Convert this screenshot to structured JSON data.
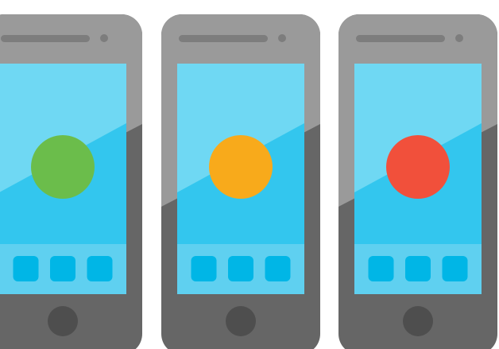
{
  "palette": {
    "body_light": "#9a9a9a",
    "body_dark": "#666666",
    "speaker": "#7d7d7d",
    "home_button": "#4e4e4e",
    "screen_light": "#6fd8f3",
    "screen_dark": "#33c6ee",
    "dock": "#5fd0f0",
    "app_icon": "#00b6e6"
  },
  "phones": [
    {
      "name": "phone-green",
      "status_dot_color": "#6bbd4b",
      "status_dot_icon": "circle-icon",
      "dock_icon_count": 3
    },
    {
      "name": "phone-orange",
      "status_dot_color": "#f8aa1b",
      "status_dot_icon": "circle-icon",
      "dock_icon_count": 3
    },
    {
      "name": "phone-red",
      "status_dot_color": "#f1503b",
      "status_dot_icon": "circle-icon",
      "dock_icon_count": 3
    }
  ]
}
